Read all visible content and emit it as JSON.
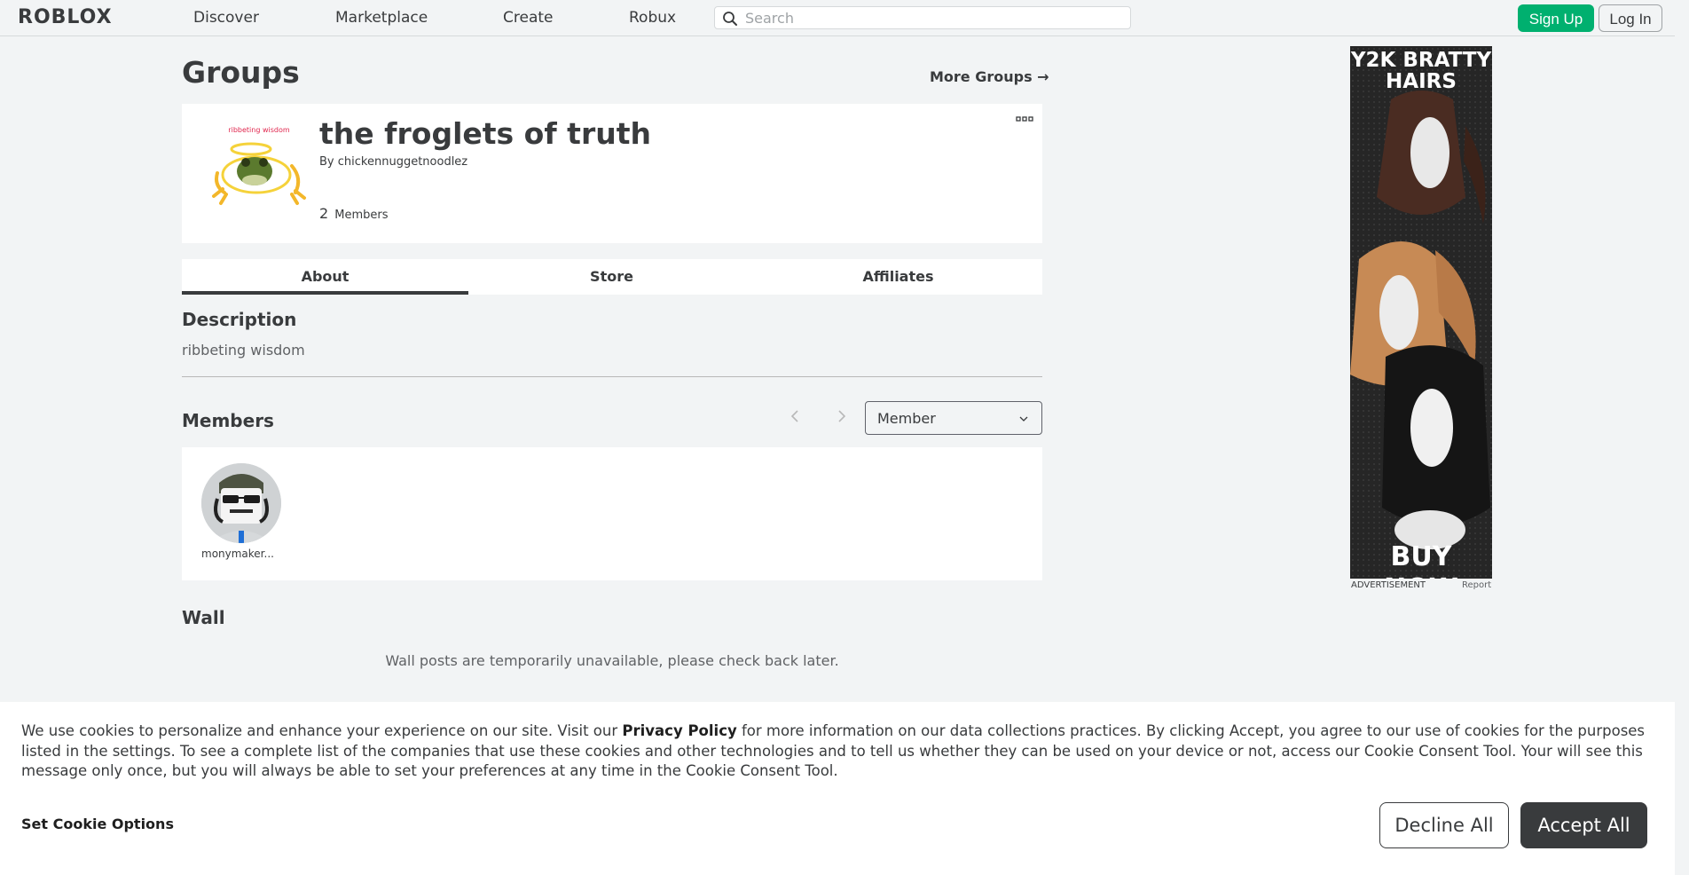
{
  "header": {
    "logo": "ROBLOX",
    "nav": [
      "Discover",
      "Marketplace",
      "Create",
      "Robux"
    ],
    "search_placeholder": "Search",
    "signup_label": "Sign Up",
    "login_label": "Log In"
  },
  "page": {
    "title": "Groups",
    "more_groups": "More Groups →"
  },
  "group": {
    "name": "the froglets of truth",
    "by_prefix": "By",
    "owner": "chickennuggetnoodlez",
    "member_count": "2",
    "members_label": "Members",
    "emblem_caption": "ribbeting wisdom"
  },
  "tabs": [
    {
      "label": "About",
      "active": true
    },
    {
      "label": "Store",
      "active": false
    },
    {
      "label": "Affiliates",
      "active": false
    }
  ],
  "about": {
    "description_heading": "Description",
    "description": "ribbeting wisdom",
    "members_heading": "Members",
    "role_selected": "Member",
    "members": [
      {
        "name": "monymaker..."
      }
    ],
    "wall_heading": "Wall",
    "wall_message": "Wall posts are temporarily unavailable, please check back later."
  },
  "ad": {
    "title": "Y2K BRATTY HAIRS",
    "cta": "BUY NOW",
    "label": "ADVERTISEMENT",
    "report": "Report"
  },
  "cookie": {
    "text_before": "We use cookies to personalize and enhance your experience on our site. Visit our ",
    "privacy_link": "Privacy Policy",
    "text_after": " for more information on our data collections practices. By clicking Accept, you agree to our use of cookies for the purposes listed in the settings. To see a complete list of the companies that use these cookies and other technologies and to tell us whether they can be used on your device or not, access our Cookie Consent Tool. Your will see this message only once, but you will always be able to set your preferences at any time in the Cookie Consent Tool.",
    "options_label": "Set Cookie Options",
    "decline_label": "Decline All",
    "accept_label": "Accept All"
  },
  "colors": {
    "accent_green": "#00b06f",
    "text": "#393b3d",
    "background": "#f2f4f5"
  }
}
